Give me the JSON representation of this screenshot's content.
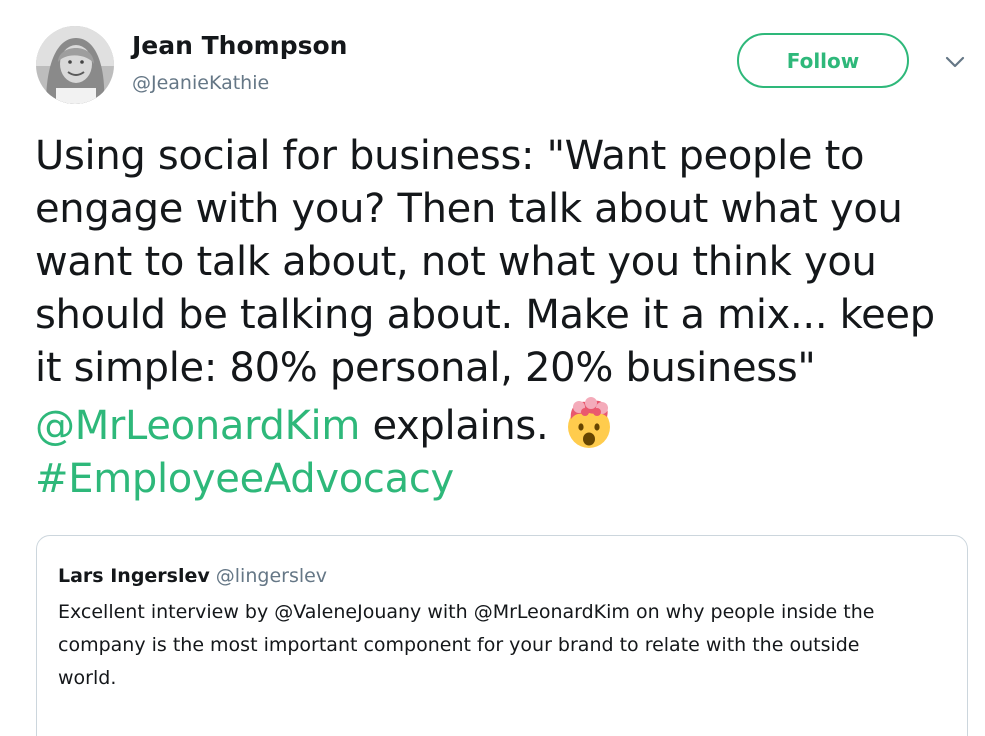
{
  "author": {
    "name": "Jean Thompson",
    "handle": "@JeanieKathie",
    "avatar_icon": "profile-photo"
  },
  "actions": {
    "follow_label": "Follow",
    "menu_icon": "chevron-down-icon"
  },
  "tweet": {
    "lines": [
      "Using social for business: \"Want people to",
      "engage with you? Then talk about what you",
      "want to talk about, not what you think you",
      "should be talking about. Make it a mix... keep",
      "it simple: 80% personal, 20% business\""
    ],
    "mention": "@MrLeonardKim",
    "after_mention": " explains. ",
    "emoji_icon": "exploding-head-emoji",
    "hashtag": "#EmployeeAdvocacy"
  },
  "quoted_tweet": {
    "name": "Lars Ingerslev",
    "handle": "@lingerslev",
    "lines": [
      "Excellent interview by @ValeneJouany with @MrLeonardKim on why people inside the",
      "company is the most important component for your brand to relate with the outside",
      "world."
    ]
  },
  "colors": {
    "accent": "#2eb87a",
    "text": "#14171a",
    "muted": "#657786",
    "border": "#ccd6dd"
  }
}
